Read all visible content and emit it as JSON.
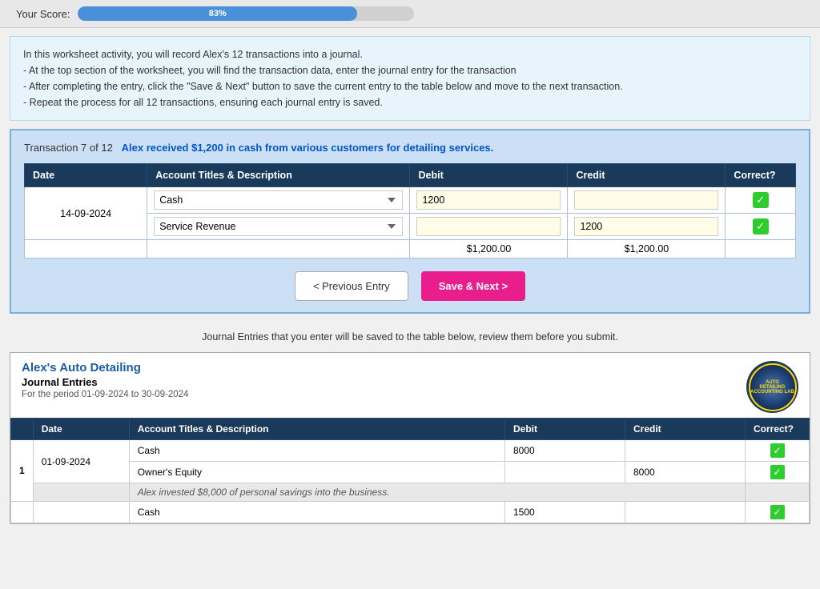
{
  "score": {
    "label": "Your Score:",
    "percent": 83,
    "percent_text": "83%"
  },
  "instructions": {
    "line1": "In this worksheet activity, you will record Alex's 12 transactions into a journal.",
    "line2": "- At the top section of the worksheet, you will find the transaction data, enter the journal entry for the transaction",
    "line3": "- After completing the entry, click the \"Save & Next\" button to save the current entry to the table below and move to the next transaction.",
    "line4": "- Repeat the process for all 12 transactions, ensuring each journal entry is saved."
  },
  "transaction": {
    "label": "Transaction 7 of 12",
    "description": "Alex received $1,200 in cash from various customers for detailing services.",
    "date": "14-09-2024",
    "rows": [
      {
        "account": "Cash",
        "debit": "1200",
        "credit": "",
        "correct": true
      },
      {
        "account": "Service Revenue",
        "debit": "",
        "credit": "1200",
        "correct": true
      }
    ],
    "total_debit": "$1,200.00",
    "total_credit": "$1,200.00",
    "columns": {
      "date": "Date",
      "account": "Account Titles & Description",
      "debit": "Debit",
      "credit": "Credit",
      "correct": "Correct?"
    }
  },
  "buttons": {
    "prev": "< Previous Entry",
    "next": "Save & Next >"
  },
  "bottom_note": "Journal Entries that you enter will be saved to the table below, review them before you submit.",
  "journal": {
    "company": "Alex's Auto Detailing",
    "title": "Journal Entries",
    "period": "For the period 01-09-2024 to 30-09-2024",
    "columns": {
      "date": "Date",
      "account": "Account Titles & Description",
      "debit": "Debit",
      "credit": "Credit",
      "correct": "Correct?"
    },
    "entries": [
      {
        "row_num": "1",
        "date": "01-09-2024",
        "lines": [
          {
            "account": "Cash",
            "debit": "8000",
            "credit": "",
            "correct": true
          },
          {
            "account": "Owner's Equity",
            "debit": "",
            "credit": "8000",
            "correct": true
          },
          {
            "account": "Alex invested $8,000 of personal savings into the business.",
            "debit": "",
            "credit": "",
            "correct": false,
            "is_desc": true
          }
        ]
      }
    ],
    "extra_row": {
      "account": "Cash",
      "debit": "1500",
      "credit": "",
      "correct": true
    },
    "logo": {
      "line1": "AUTO",
      "line2": "DETAILING",
      "line3": "ACCOUNTING LAB"
    }
  }
}
